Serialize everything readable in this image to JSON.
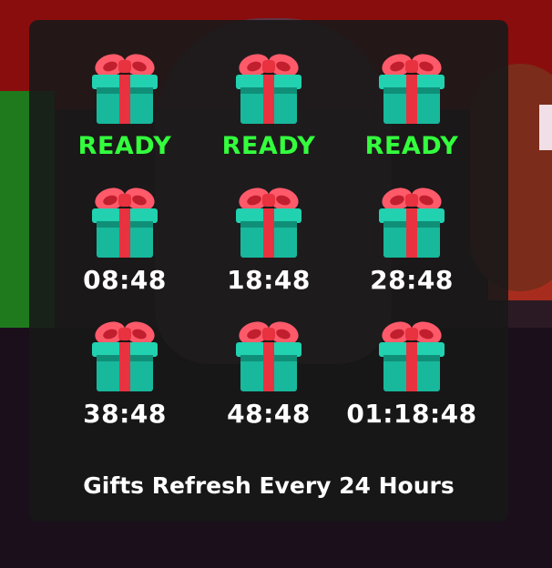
{
  "colors": {
    "panel_bg": "#181818",
    "ready_text": "#33ff3d",
    "timer_text": "#ffffff",
    "gift_box": "#18b89c",
    "gift_ribbon": "#e8323f",
    "gift_bow": "#ff5a6a"
  },
  "gifts": [
    {
      "icon": "gift-icon",
      "status": "READY",
      "ready": true
    },
    {
      "icon": "gift-icon",
      "status": "READY",
      "ready": true
    },
    {
      "icon": "gift-icon",
      "status": "READY",
      "ready": true
    },
    {
      "icon": "gift-icon",
      "status": "08:48",
      "ready": false
    },
    {
      "icon": "gift-icon",
      "status": "18:48",
      "ready": false
    },
    {
      "icon": "gift-icon",
      "status": "28:48",
      "ready": false
    },
    {
      "icon": "gift-icon",
      "status": "38:48",
      "ready": false
    },
    {
      "icon": "gift-icon",
      "status": "48:48",
      "ready": false
    },
    {
      "icon": "gift-icon",
      "status": "01:18:48",
      "ready": false
    }
  ],
  "footer": {
    "text": "Gifts Refresh Every 24 Hours"
  }
}
